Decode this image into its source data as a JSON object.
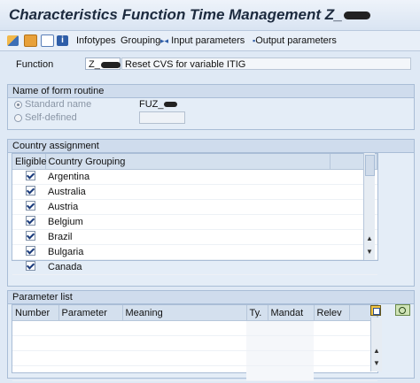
{
  "window": {
    "title": "Characteristics Function Time Management Z_"
  },
  "toolbar": {
    "infotypes_label": "Infotypes",
    "grouping_label": "Grouping",
    "input_params_label": "Input parameters",
    "output_params_label": "Output parameters"
  },
  "function": {
    "label": "Function",
    "value": "Z_",
    "description": "Reset CVS for variable ITIG"
  },
  "form_routine": {
    "header": "Name of form routine",
    "standard_label": "Standard name",
    "self_defined_label": "Self-defined",
    "standard_value": "FUZ_"
  },
  "country_assignment": {
    "header": "Country assignment",
    "columns": [
      "Eligible",
      "Country Grouping"
    ],
    "rows": [
      "Argentina",
      "Australia",
      "Austria",
      "Belgium",
      "Brazil",
      "Bulgaria",
      "Canada"
    ]
  },
  "parameter_list": {
    "header": "Parameter list",
    "columns": [
      "Number",
      "Parameter",
      "Meaning",
      "Ty.",
      "Mandat",
      "Relev"
    ]
  }
}
